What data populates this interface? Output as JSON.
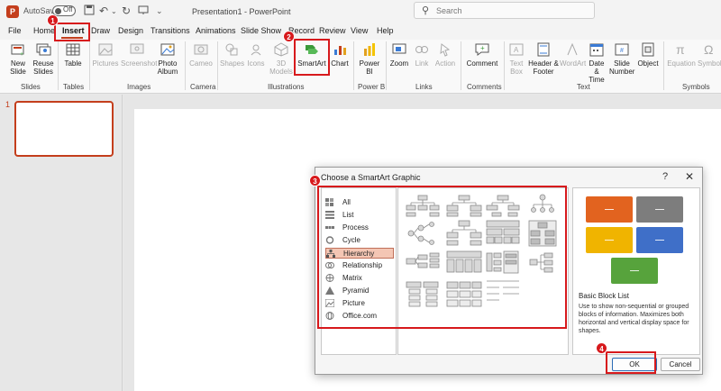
{
  "titlebar": {
    "autosave_label": "AutoSave",
    "toggle_state": "Off",
    "document_title": "Presentation1 - PowerPoint",
    "search_placeholder": "Search"
  },
  "tabs": [
    "File",
    "Home",
    "Insert",
    "Draw",
    "Design",
    "Transitions",
    "Animations",
    "Slide Show",
    "Record",
    "Review",
    "View",
    "Help"
  ],
  "active_tab": "Insert",
  "ribbon": {
    "buttons": {
      "new_slide": "New Slide",
      "reuse_slides": "Reuse Slides",
      "table": "Table",
      "pictures": "Pictures",
      "screenshot": "Screenshot",
      "photo_album": "Photo Album",
      "cameo": "Cameo",
      "shapes": "Shapes",
      "icons": "Icons",
      "models3d": "3D Models",
      "smartart": "SmartArt",
      "chart": "Chart",
      "powerbi": "Power BI",
      "zoom": "Zoom",
      "link": "Link",
      "action": "Action",
      "comment": "Comment",
      "textbox": "Text Box",
      "header_footer": "Header & Footer",
      "wordart": "WordArt",
      "date_time": "Date & Time",
      "slide_number": "Slide Number",
      "object": "Object",
      "equation": "Equation",
      "symbol": "Symbol"
    },
    "groups": [
      "Slides",
      "Tables",
      "Images",
      "Camera",
      "Illustrations",
      "Power BI",
      "Links",
      "Comments",
      "Text",
      "Symbols"
    ]
  },
  "slide_panel": {
    "slide_number": "1"
  },
  "dialog": {
    "title": "Choose a SmartArt Graphic",
    "help": "?",
    "close": "✕",
    "categories": [
      "All",
      "List",
      "Process",
      "Cycle",
      "Hierarchy",
      "Relationship",
      "Matrix",
      "Pyramid",
      "Picture",
      "Office.com"
    ],
    "selected_category": "Hierarchy",
    "preview_title": "Basic Block List",
    "preview_description": "Use to show non-sequential or grouped blocks of information. Maximizes both horizontal and vertical display space for shapes.",
    "ok_label": "OK",
    "cancel_label": "Cancel",
    "preview_colors": [
      "#e2631f",
      "#7d7d7d",
      "#f0b400",
      "#3f6fc8",
      "#57a33c"
    ]
  },
  "callouts": [
    "1",
    "2",
    "3",
    "4"
  ]
}
